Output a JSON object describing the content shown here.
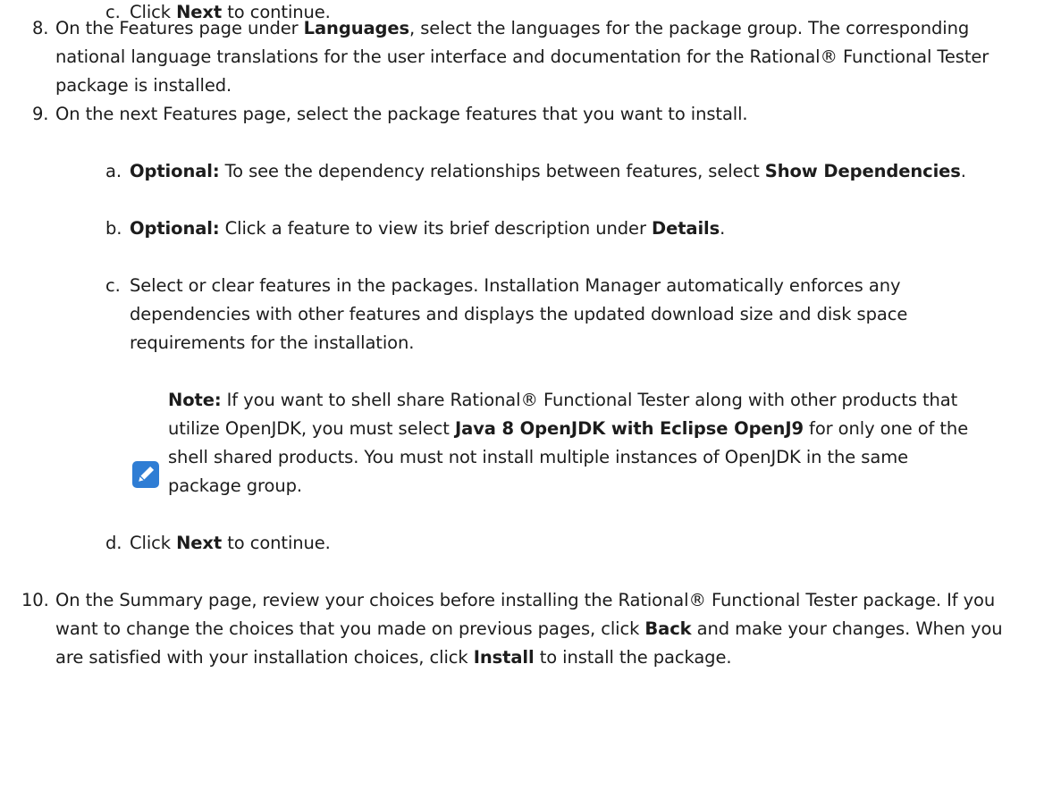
{
  "step7c": {
    "marker": "c.",
    "pre": "Click ",
    "bold": "Next",
    "post": " to continue."
  },
  "step8": {
    "marker": "8.",
    "line1_pre": "On the Features page under ",
    "line1_bold": "Languages",
    "line1_post": ", select the languages for the package group. The corresponding",
    "line2": "national language translations for the user interface and documentation for the Rational® Functional Tester",
    "line3": "package is installed."
  },
  "step9": {
    "marker": "9.",
    "text": "On the next Features page, select the package features that you want to install.",
    "a": {
      "marker": "a.",
      "label": "Optional:",
      "pre": " To see the dependency relationships between features, select ",
      "bold": "Show Dependencies",
      "post": "."
    },
    "b": {
      "marker": "b.",
      "label": "Optional:",
      "pre": " Click a feature to view its brief description under ",
      "bold": "Details",
      "post": "."
    },
    "c": {
      "marker": "c.",
      "line1": "Select or clear features in the packages. Installation Manager automatically enforces any",
      "line2": "dependencies with other features and displays the updated download size and disk space",
      "line3": "requirements for the installation."
    },
    "note": {
      "icon": "pencil-icon",
      "icon_color": "#2f7dd4",
      "label": "Note:",
      "line1_post": " If you want to shell share Rational® Functional Tester along with other products that",
      "line2_pre": "utilize OpenJDK, you must select ",
      "line2_bold": "Java 8 OpenJDK with Eclipse OpenJ9",
      "line2_post": " for only one of the",
      "line3": "shell shared products. You must not install multiple instances of OpenJDK in the same",
      "line4": "package group."
    },
    "d": {
      "marker": "d.",
      "pre": "Click ",
      "bold": "Next",
      "post": " to continue."
    }
  },
  "step10": {
    "marker": "10.",
    "line1": "On the Summary page, review your choices before installing the Rational® Functional Tester package. If you",
    "line2_pre": "want to change the choices that you made on previous pages, click ",
    "line2_bold": "Back",
    "line2_post": " and make your changes. When you",
    "line3_pre": "are satisfied with your installation choices, click ",
    "line3_bold": "Install",
    "line3_post": " to install the package."
  }
}
